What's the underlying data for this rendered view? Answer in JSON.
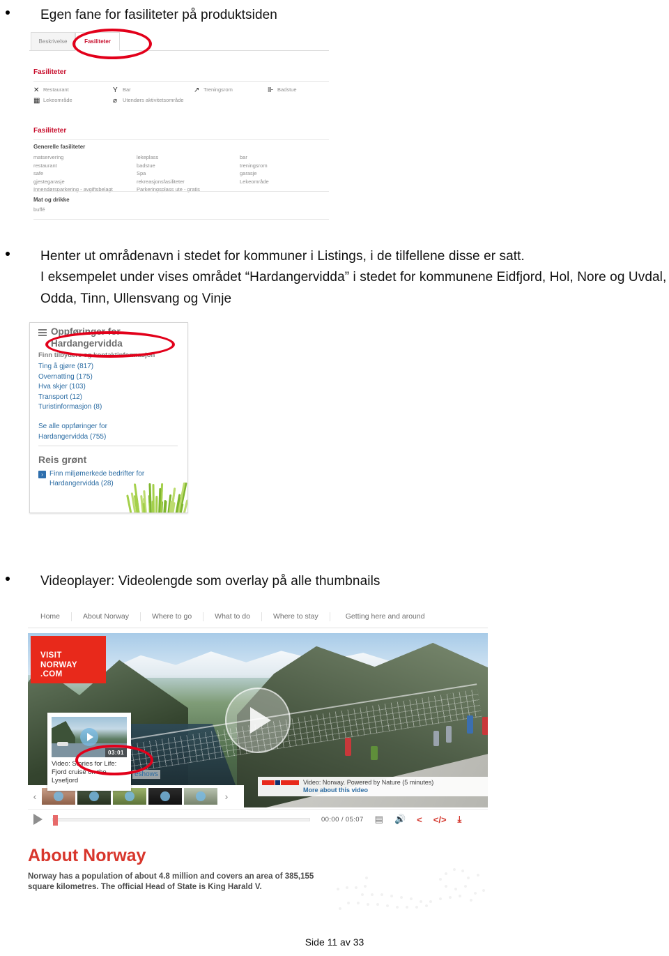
{
  "document": {
    "footer": "Side 11 av 33"
  },
  "bullets": [
    {
      "id": "b1",
      "text": "Egen fane for fasiliteter på produktsiden"
    },
    {
      "id": "b2",
      "text": "Henter ut områdenavn i stedet for kommuner i Listings, i de tilfellene disse er satt."
    },
    {
      "id": "b3",
      "text": "I eksempelet under vises området “Hardangervidda” i stedet for kommunene Eidfjord, Hol, Nore og Uvdal, Odda, Tinn, Ullensvang og Vinje"
    },
    {
      "id": "b4",
      "text": "Videoplayer: Videolengde som overlay på alle thumbnails"
    }
  ],
  "facilities_shot": {
    "tabs": [
      {
        "label": "Beskrivelse",
        "active": false
      },
      {
        "label": "Fasiliteter",
        "active": true
      }
    ],
    "section_title_1": "Fasiliteter",
    "icons": [
      {
        "glyph": "✕",
        "icon_name": "cutlery-icon",
        "label": "Restaurant"
      },
      {
        "glyph": "Y",
        "icon_name": "cocktail-glass-icon",
        "label": "Bar"
      },
      {
        "glyph": "↗",
        "icon_name": "dumbbell-icon",
        "label": "Treningsrom"
      },
      {
        "glyph": "⊪",
        "icon_name": "sauna-icon",
        "label": "Badstue"
      },
      {
        "glyph": "▦",
        "icon_name": "playground-icon",
        "label": "Lekeområde"
      },
      {
        "glyph": "⌀",
        "icon_name": "outdoor-activity-icon",
        "label": "Utendørs aktivitetsområde"
      }
    ],
    "section_title_2": "Fasiliteter",
    "general_heading": "Generelle fasiliteter",
    "general_columns": [
      [
        "matservering",
        "restaurant",
        "safe",
        "gjestegarasje",
        "Innendørsparkering - avgiftsbelagt"
      ],
      [
        "lekeplass",
        "badstue",
        "Spa",
        "rekreasjonsfasiliteter",
        "Parkeringsplass ute - gratis"
      ],
      [
        "bar",
        "treningsrom",
        "garasje",
        "Lekeområde"
      ]
    ],
    "food_heading": "Mat og drikke",
    "food_items": [
      "buffé"
    ]
  },
  "listings_shot": {
    "title_line1": "Oppføringer for",
    "title_line2": "Hardangervidda",
    "subtitle": "Finn tilbydere og kontaktinformasjon",
    "links": [
      "Ting å gjøre (817)",
      "Overnatting (175)",
      "Hva skjer (103)",
      "Transport (12)",
      "Turistinformasjon (8)"
    ],
    "see_all_line1": "Se alle oppføringer for",
    "see_all_line2": "Hardangervidda (755)",
    "green_heading": "Reis grønt",
    "green_link_line1": "Finn miljømerkede bedrifter for",
    "green_link_line2": "Hardangervidda (28)"
  },
  "video_shot": {
    "nav": [
      "Home",
      "About Norway",
      "Where to go",
      "What to do",
      "Where to stay",
      "Getting here and around"
    ],
    "logo_line1": "VISIT",
    "logo_line2": "NORWAY",
    "logo_line3": ".COM",
    "thumb_popup": {
      "duration": "03:01",
      "caption": "Video: Stories for Life: Fjord cruise on the Lysefjord"
    },
    "slideshows_label": "eshows",
    "info": {
      "title": "Video: Norway. Powered by Nature (5 minutes)",
      "more_link": "More about this video"
    },
    "controls": {
      "time": "00:00 / 05:07",
      "save_icon": "save-icon",
      "volume_icon": "volume-icon",
      "share_icon": "share-icon",
      "embed_icon": "embed-code-icon",
      "download_icon": "download-icon",
      "prev_icon": "prev-arrow-icon",
      "next_icon": "next-arrow-icon"
    }
  },
  "about_norway": {
    "heading": "About Norway",
    "paragraph": "Norway has a population of about 4.8 million and covers an area of 385,155 square kilometres. The official Head of State is King Harald V."
  },
  "colors": {
    "brand_red": "#c8102e",
    "annotation_red": "#e2001a",
    "link_blue": "#2b6ca3",
    "visit_norway_red": "#e8291b"
  }
}
